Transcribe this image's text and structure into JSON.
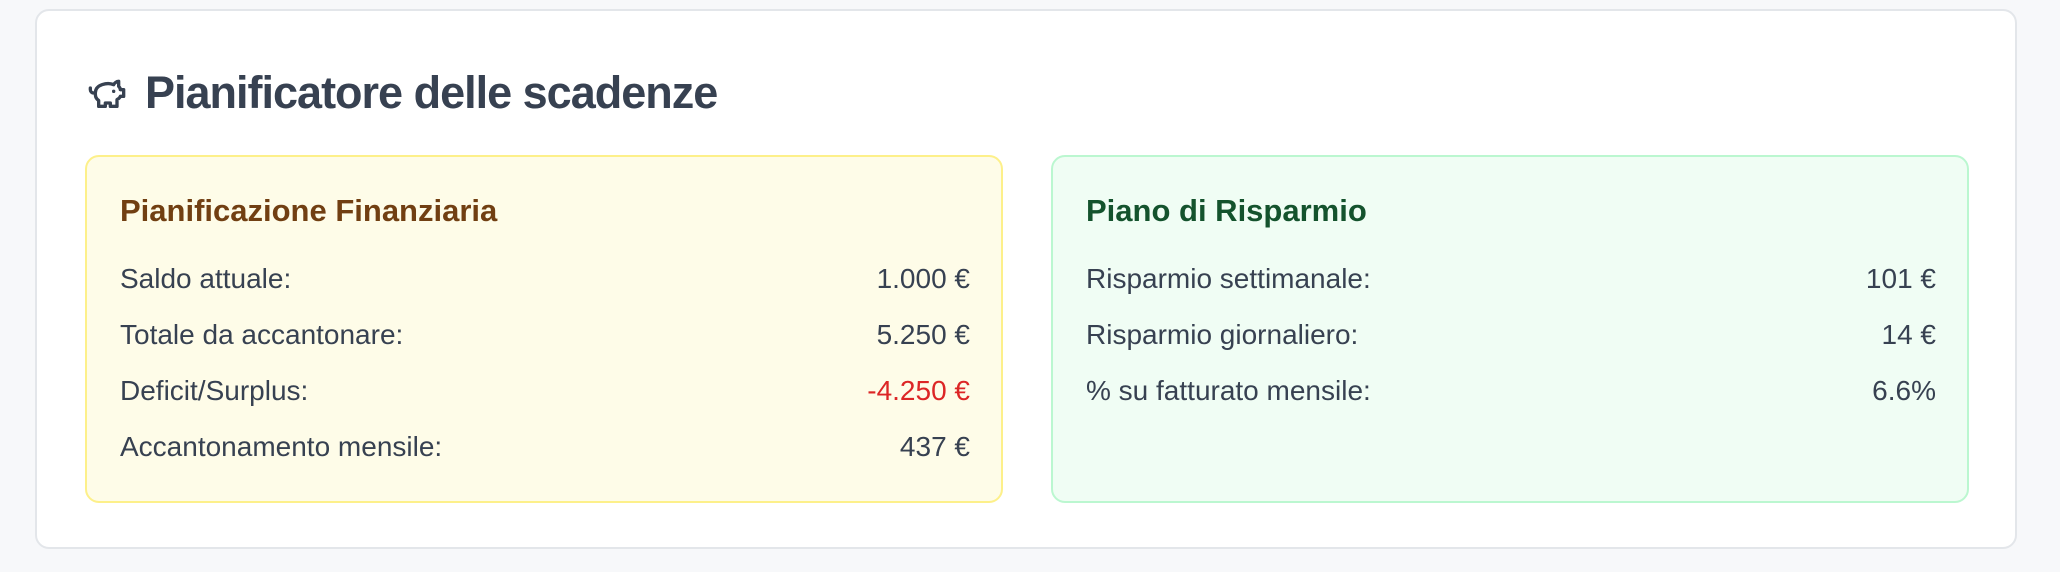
{
  "header": {
    "icon": "piggy-bank-icon",
    "title": "Pianificatore delle scadenze"
  },
  "financial": {
    "title": "Pianificazione Finanziaria",
    "rows": [
      {
        "label": "Saldo attuale:",
        "value": "1.000 €"
      },
      {
        "label": "Totale da accantonare:",
        "value": "5.250 €"
      },
      {
        "label": "Deficit/Surplus:",
        "value": "-4.250 €"
      },
      {
        "label": "Accantonamento mensile:",
        "value": "437 €"
      }
    ]
  },
  "savings": {
    "title": "Piano di Risparmio",
    "rows": [
      {
        "label": "Risparmio settimanale:",
        "value": "101 €"
      },
      {
        "label": "Risparmio giornaliero:",
        "value": "14 €"
      },
      {
        "label": "% su fatturato mensile:",
        "value": "6.6%"
      }
    ]
  },
  "colors": {
    "title": "#374151",
    "financial_bg": "#fefce8",
    "financial_border": "#fdf08a",
    "financial_title": "#713f12",
    "savings_bg": "#f0fdf4",
    "savings_border": "#bbf7d0",
    "savings_title": "#14532d",
    "negative": "#dc2626"
  }
}
